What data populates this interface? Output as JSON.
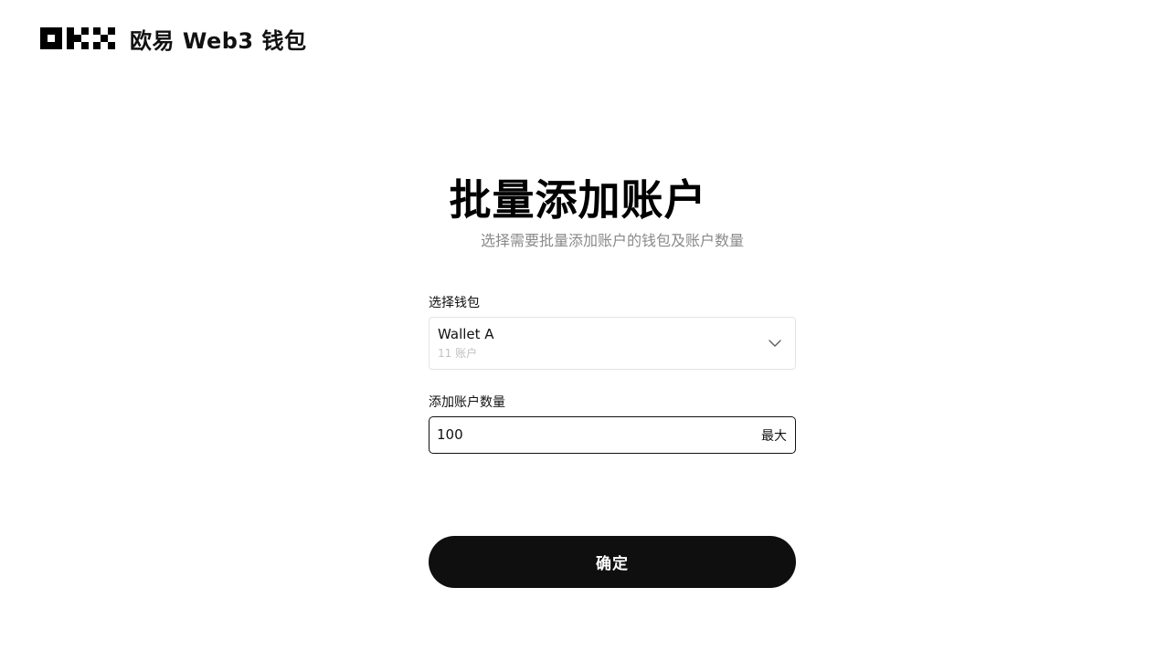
{
  "header": {
    "brand": "欧易 Web3 钱包",
    "logo_icon": "okx-logo-icon"
  },
  "main": {
    "title": "批量添加账户",
    "subtitle": "选择需要批量添加账户的钱包及账户数量"
  },
  "wallet_field": {
    "label": "选择钱包",
    "selected_name": "Wallet A",
    "selected_count": "11 账户",
    "icon": "chevron-down-icon"
  },
  "amount_field": {
    "label": "添加账户数量",
    "value": "100",
    "max_label": "最大"
  },
  "confirm": {
    "label": "确定"
  },
  "colors": {
    "background": "#ffffff",
    "primary": "#0f0f0f",
    "muted_text": "#8a8a8a",
    "placeholder_text": "#c2c2c2",
    "border": "#e3e3e3"
  }
}
